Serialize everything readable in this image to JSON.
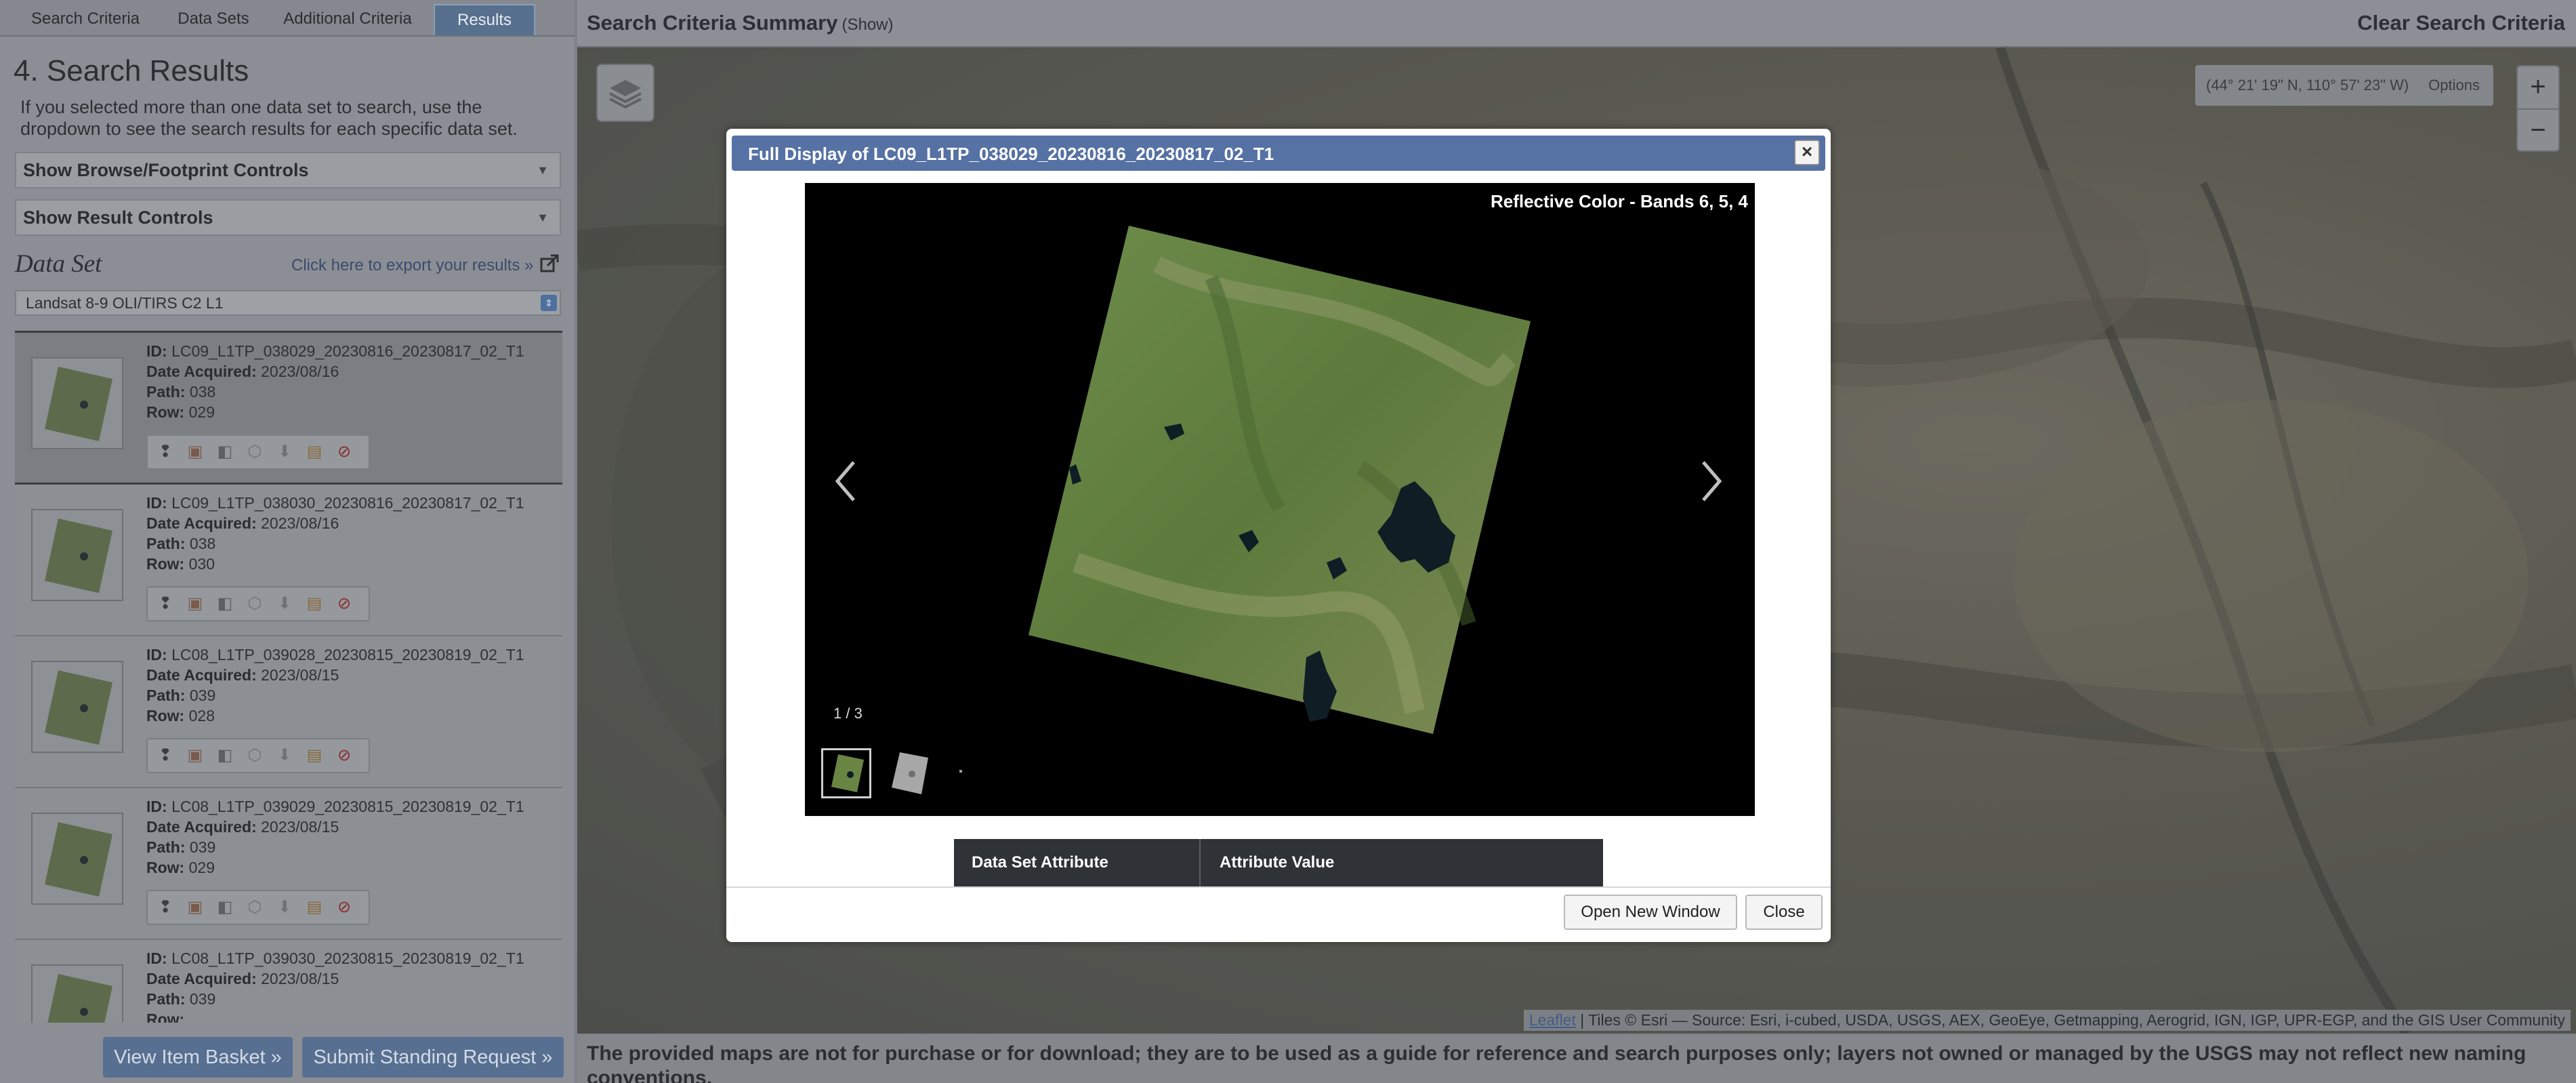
{
  "tabs": [
    {
      "label": "Search Criteria"
    },
    {
      "label": "Data Sets"
    },
    {
      "label": "Additional Criteria"
    },
    {
      "label": "Results"
    }
  ],
  "results_panel": {
    "title": "4. Search Results",
    "help": "If you selected more than one data set to search, use the dropdown to see the search results for each specific data set.",
    "browse_controls": "Show Browse/Footprint Controls",
    "result_controls": "Show Result Controls",
    "dataset_label": "Data Set",
    "export_link": "Click here to export your results »",
    "dataset_selected": "Landsat 8-9 OLI/TIRS C2 L1",
    "field_labels": {
      "id": "ID:",
      "date": "Date Acquired:",
      "path": "Path:",
      "row": "Row:"
    },
    "results": [
      {
        "id": "LC09_L1TP_038029_20230816_20230817_02_T1",
        "date": "2023/08/16",
        "path": "038",
        "row": "029"
      },
      {
        "id": "LC09_L1TP_038030_20230816_20230817_02_T1",
        "date": "2023/08/16",
        "path": "038",
        "row": "030"
      },
      {
        "id": "LC08_L1TP_039028_20230815_20230819_02_T1",
        "date": "2023/08/15",
        "path": "039",
        "row": "028"
      },
      {
        "id": "LC08_L1TP_039029_20230815_20230819_02_T1",
        "date": "2023/08/15",
        "path": "039",
        "row": "029"
      },
      {
        "id": "LC08_L1TP_039030_20230815_20230819_02_T1",
        "date": "2023/08/15",
        "path": "039",
        "row": ""
      }
    ],
    "result_action_icons": [
      "footprint-icon",
      "browse-overlay-icon",
      "metadata-icon",
      "compare-icon",
      "download-icon",
      "order-icon",
      "exclude-icon"
    ],
    "buttons": {
      "basket": "View Item Basket »",
      "standing": "Submit Standing Request »"
    }
  },
  "header": {
    "summary": "Search Criteria Summary",
    "show": "(Show)",
    "clear": "Clear Search Criteria"
  },
  "map": {
    "coordinates": "(44° 21' 19\" N, 110° 57' 23\" W)",
    "options": "Options",
    "zoom_in": "+",
    "zoom_out": "−",
    "attribution_link": "Leaflet",
    "attribution_text": " | Tiles © Esri — Source: Esri, i-cubed, USDA, USGS, AEX, GeoEye, Getmapping, Aerogrid, IGN, IGP, UPR-EGP, and the GIS User Community",
    "disclaimer": "The provided maps are not for purchase or for download; they are to be used as a guide for reference and search purposes only; layers not owned or managed by the USGS may not reflect new naming conventions."
  },
  "modal": {
    "title": "Full Display of LC09_L1TP_038029_20230816_20230817_02_T1",
    "close_x": "×",
    "band_label": "Reflective Color - Bands 6, 5, 4",
    "counter": "1 / 3",
    "table_headers": [
      "Data Set Attribute",
      "Attribute Value"
    ],
    "buttons": {
      "new_window": "Open New Window",
      "close": "Close"
    }
  },
  "colors": {
    "titlebar": "#5671a3",
    "active_tab": "#56708d",
    "panel_bg": "#8b8f95",
    "scene_green": "#5d7a3c",
    "lake": "#0f1d24"
  }
}
